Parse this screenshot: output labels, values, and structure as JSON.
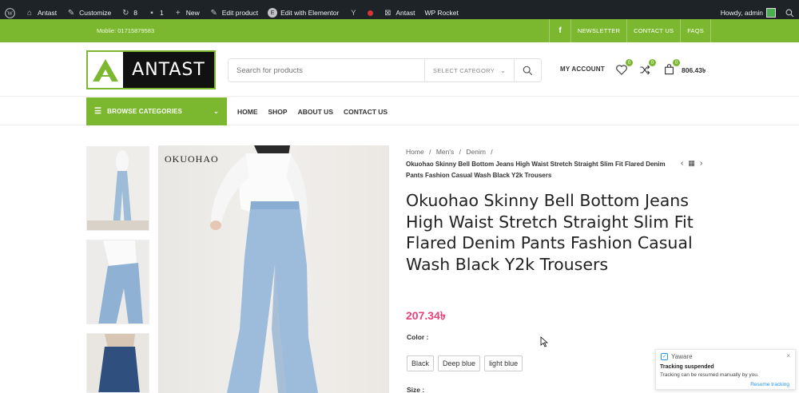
{
  "admin_bar": {
    "site_name": "Antast",
    "customize": "Customize",
    "updates_count": "8",
    "comments_count": "1",
    "new_label": "New",
    "edit_product": "Edit product",
    "edit_elementor": "Edit with Elementor",
    "antast_label": "Antast",
    "wp_rocket": "WP Rocket",
    "howdy": "Howdy, admin"
  },
  "topbar": {
    "mobile": "Moblie: 01715879583",
    "links": [
      "NEWSLETTER",
      "CONTACT US",
      "FAQS"
    ],
    "social": "f"
  },
  "header": {
    "logo_text": "ANTAST",
    "search_placeholder": "Search for products",
    "select_category": "SELECT CATEGORY",
    "my_account": "MY ACCOUNT",
    "wishlist_count": "0",
    "compare_count": "0",
    "cart_count": "0",
    "cart_total": "806.43৳"
  },
  "nav": {
    "browse": "BROWSE CATEGORIES",
    "menu": [
      "HOME",
      "SHOP",
      "ABOUT US",
      "CONTACT US"
    ]
  },
  "gallery": {
    "brand_text": "OKUOHAO"
  },
  "product": {
    "breadcrumb": [
      "Home",
      "/",
      "Men's",
      "/",
      "Denim",
      "/"
    ],
    "breadcrumb_title": "Okuohao Skinny Bell Bottom Jeans High Waist Stretch Straight Slim Fit Flared Denim Pants Fashion Casual Wash Black Y2k Trousers",
    "title": "Okuohao Skinny Bell Bottom Jeans High Waist Stretch Straight Slim Fit Flared Denim Pants Fashion Casual Wash Black Y2k Trousers",
    "price": "207.34৳",
    "color_label": "Color :",
    "colors": [
      "Black",
      "Deep blue",
      "light blue"
    ],
    "size_label": "Size :"
  },
  "popup": {
    "app": "Yaware",
    "title": "Tracking suspended",
    "message": "Tracking can be resumed manually by you.",
    "action": "Resume tracking",
    "close": "×"
  },
  "colors": {
    "accent": "#7cb82f",
    "price": "#e3447a",
    "admin_bar": "#1d2327"
  }
}
